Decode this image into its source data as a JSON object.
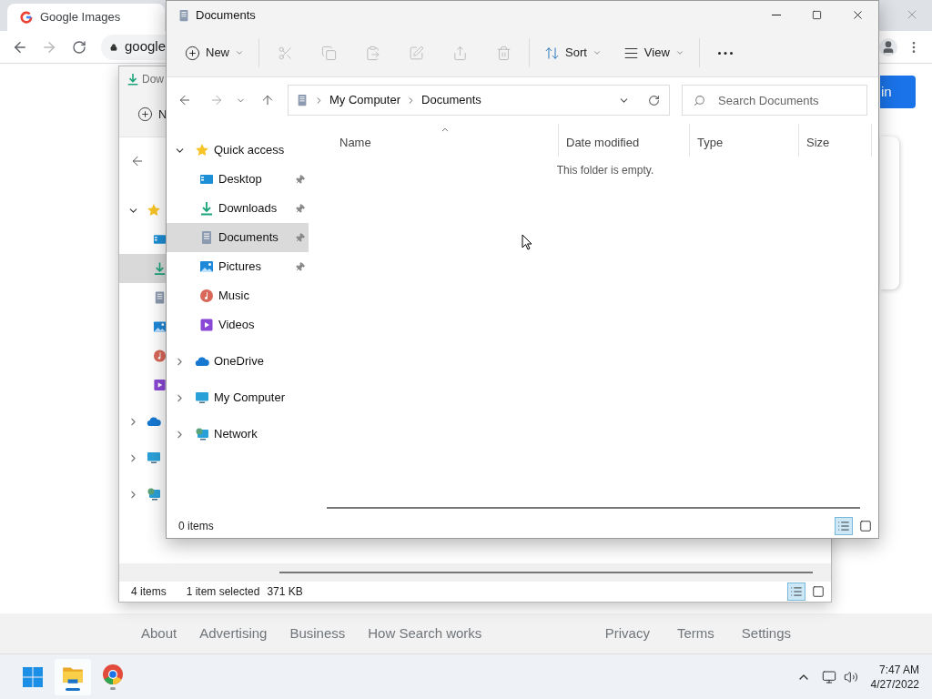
{
  "browser": {
    "tab_title": "Google Images",
    "address": "google",
    "sign_in": "in",
    "footer_left": [
      "About",
      "Advertising",
      "Business",
      "How Search works"
    ],
    "footer_right": [
      "Privacy",
      "Terms",
      "Settings"
    ]
  },
  "back_window": {
    "title": "Dow",
    "new_label": "N",
    "tree": [
      {
        "kind": "star",
        "expanded": true,
        "children": [
          {
            "kind": "desktop",
            "selected": false
          },
          {
            "kind": "downloads",
            "selected": true
          },
          {
            "kind": "documents",
            "selected": false
          },
          {
            "kind": "pictures",
            "selected": false
          },
          {
            "kind": "music",
            "selected": false
          },
          {
            "kind": "videos",
            "selected": false
          }
        ]
      },
      {
        "kind": "cloud",
        "expanded": false
      },
      {
        "kind": "computer",
        "expanded": false
      },
      {
        "kind": "network",
        "expanded": false
      }
    ],
    "status": "4 items",
    "selection": "1 item selected",
    "size": "371 KB",
    "view_modes": [
      {
        "kind": "details",
        "selected": true
      },
      {
        "kind": "tiles",
        "selected": false
      }
    ]
  },
  "window": {
    "title": "Documents"
  },
  "toolbar_groups": [
    [
      {
        "kind": "new",
        "label": "New",
        "dropdown": true,
        "disabled": false
      }
    ],
    [
      {
        "kind": "cut",
        "disabled": true
      },
      {
        "kind": "copy",
        "disabled": true
      },
      {
        "kind": "paste",
        "disabled": true
      },
      {
        "kind": "rename",
        "disabled": true
      },
      {
        "kind": "share",
        "disabled": true
      },
      {
        "kind": "delete",
        "disabled": true
      }
    ],
    [
      {
        "kind": "sort",
        "label": "Sort",
        "dropdown": true,
        "disabled": false
      },
      {
        "kind": "view",
        "label": "View",
        "dropdown": true,
        "disabled": false
      }
    ],
    [
      {
        "kind": "more",
        "disabled": false
      }
    ]
  ],
  "breadcrumb": [
    "My Computer",
    "Documents"
  ],
  "search": {
    "placeholder": "Search Documents"
  },
  "nav_tree": [
    {
      "label": "Quick access",
      "kind": "star",
      "expanded": true,
      "selected": false,
      "children": [
        {
          "label": "Desktop",
          "kind": "desktop",
          "pinned": true,
          "selected": false
        },
        {
          "label": "Downloads",
          "kind": "downloads",
          "pinned": true,
          "selected": false
        },
        {
          "label": "Documents",
          "kind": "documents",
          "pinned": true,
          "selected": true
        },
        {
          "label": "Pictures",
          "kind": "pictures",
          "pinned": true,
          "selected": false
        },
        {
          "label": "Music",
          "kind": "music",
          "pinned": false,
          "selected": false
        },
        {
          "label": "Videos",
          "kind": "videos",
          "pinned": false,
          "selected": false
        }
      ]
    },
    {
      "label": "OneDrive",
      "kind": "cloud",
      "expanded": false,
      "selected": false
    },
    {
      "label": "My Computer",
      "kind": "computer",
      "expanded": false,
      "selected": false
    },
    {
      "label": "Network",
      "kind": "network",
      "expanded": false,
      "selected": false
    }
  ],
  "columns": [
    {
      "label": "Name",
      "sorted": true
    },
    {
      "label": "Date modified",
      "sorted": false
    },
    {
      "label": "Type",
      "sorted": false
    },
    {
      "label": "Size",
      "sorted": false
    }
  ],
  "empty_message": "This folder is empty.",
  "status": "0 items",
  "view_modes": [
    {
      "kind": "details",
      "selected": true
    },
    {
      "kind": "tiles",
      "selected": false
    }
  ],
  "taskbar": {
    "apps": [
      {
        "kind": "start",
        "selected": false
      },
      {
        "kind": "explorer",
        "selected": true
      },
      {
        "kind": "browser",
        "selected": false
      }
    ],
    "time": "7:47 AM",
    "date": "4/27/2022"
  }
}
